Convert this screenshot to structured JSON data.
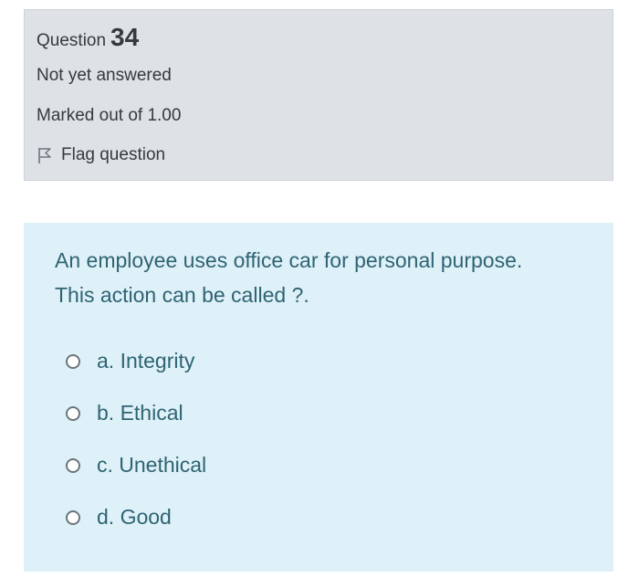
{
  "question_info": {
    "question_word": "Question",
    "question_number": "34",
    "state": "Not yet answered",
    "grade": "Marked out of 1.00",
    "flag_label": "Flag question",
    "flag_icon": "flag-outline-icon"
  },
  "question": {
    "text_line1": "An employee uses office car for personal purpose.",
    "text_line2": "This action can be called ?.",
    "options": [
      {
        "label": "a. Integrity",
        "selected": false
      },
      {
        "label": "b. Ethical",
        "selected": false
      },
      {
        "label": "c. Unethical",
        "selected": false
      },
      {
        "label": "d. Good",
        "selected": false
      }
    ]
  },
  "colors": {
    "info_background": "#dee2e6",
    "question_background": "#def0f8",
    "question_text": "#2f6473",
    "info_text": "#373a3c"
  }
}
